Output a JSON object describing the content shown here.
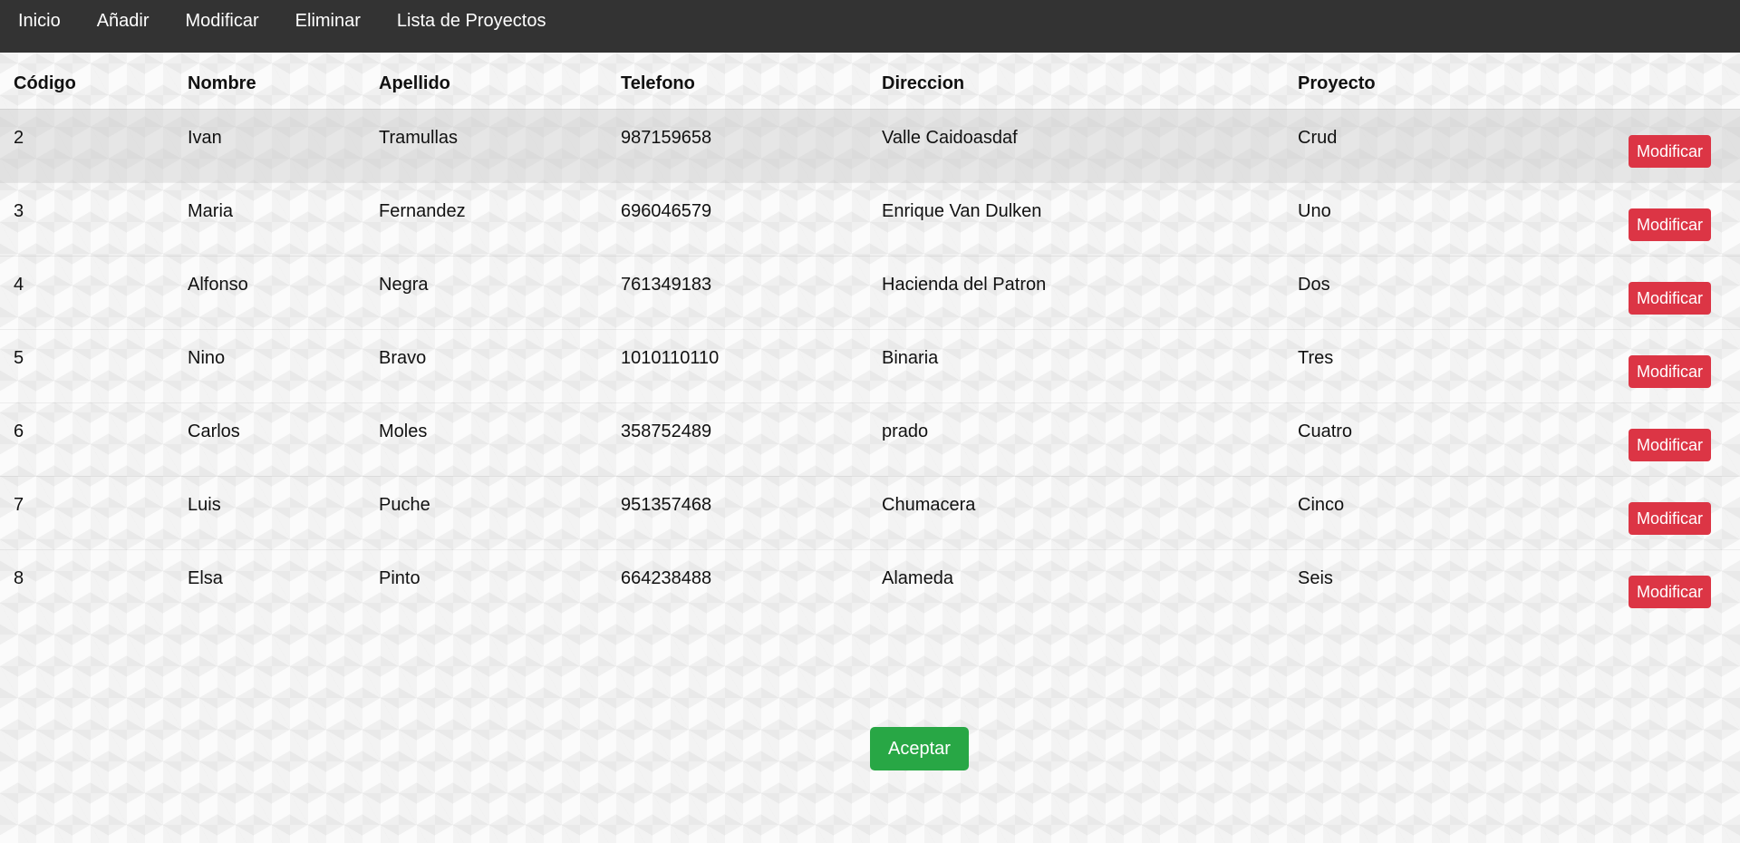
{
  "nav": {
    "items": [
      "Inicio",
      "Añadir",
      "Modificar",
      "Eliminar",
      "Lista de Proyectos"
    ]
  },
  "table": {
    "headers": [
      "Código",
      "Nombre",
      "Apellido",
      "Telefono",
      "Direccion",
      "Proyecto"
    ],
    "rows": [
      {
        "codigo": "2",
        "nombre": "Ivan",
        "apellido": "Tramullas",
        "telefono": "987159658",
        "direccion": "Valle Caidoasdaf",
        "proyecto": "Crud",
        "action": "Modificar"
      },
      {
        "codigo": "3",
        "nombre": "Maria",
        "apellido": "Fernandez",
        "telefono": "696046579",
        "direccion": "Enrique Van Dulken",
        "proyecto": "Uno",
        "action": "Modificar"
      },
      {
        "codigo": "4",
        "nombre": "Alfonso",
        "apellido": "Negra",
        "telefono": "761349183",
        "direccion": "Hacienda del Patron",
        "proyecto": "Dos",
        "action": "Modificar"
      },
      {
        "codigo": "5",
        "nombre": "Nino",
        "apellido": "Bravo",
        "telefono": "1010110110",
        "direccion": "Binaria",
        "proyecto": "Tres",
        "action": "Modificar"
      },
      {
        "codigo": "6",
        "nombre": "Carlos",
        "apellido": "Moles",
        "telefono": "358752489",
        "direccion": "prado",
        "proyecto": "Cuatro",
        "action": "Modificar"
      },
      {
        "codigo": "7",
        "nombre": "Luis",
        "apellido": "Puche",
        "telefono": "951357468",
        "direccion": "Chumacera",
        "proyecto": "Cinco",
        "action": "Modificar"
      },
      {
        "codigo": "8",
        "nombre": "Elsa",
        "apellido": "Pinto",
        "telefono": "664238488",
        "direccion": "Alameda",
        "proyecto": "Seis",
        "action": "Modificar"
      }
    ]
  },
  "footer": {
    "accept_label": "Aceptar"
  },
  "colors": {
    "navbar": "#333333",
    "modify_button": "#dc3545",
    "accept_button": "#28a745"
  }
}
